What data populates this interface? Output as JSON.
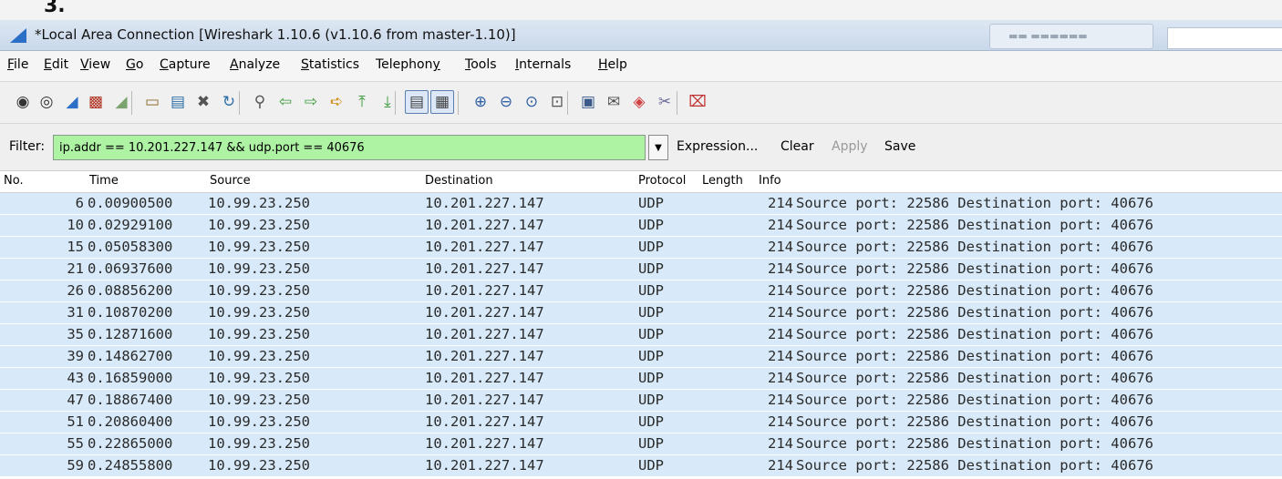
{
  "caption": "3.",
  "window": {
    "title": "*Local Area Connection  [Wireshark 1.10.6  (v1.10.6 from master-1.10)]"
  },
  "menu": {
    "items": [
      {
        "mnemonic": "F",
        "rest": "ile"
      },
      {
        "mnemonic": "E",
        "rest": "dit"
      },
      {
        "mnemonic": "V",
        "rest": "iew"
      },
      {
        "mnemonic": "G",
        "rest": "o"
      },
      {
        "mnemonic": "C",
        "rest": "apture"
      },
      {
        "mnemonic": "A",
        "rest": "nalyze"
      },
      {
        "mnemonic": "S",
        "rest": "tatistics"
      },
      {
        "pre": "Telephon",
        "mnemonic": "y",
        "rest": ""
      },
      {
        "mnemonic": "T",
        "rest": "ools"
      },
      {
        "mnemonic": "I",
        "rest": "nternals"
      },
      {
        "mnemonic": "H",
        "rest": "elp"
      }
    ]
  },
  "toolbar": {
    "icons": [
      "interface-list-icon",
      "capture-options-icon",
      "start-capture-icon",
      "stop-capture-icon",
      "restart-capture-icon",
      "open-file-icon",
      "save-file-icon",
      "close-file-icon",
      "reload-icon",
      "find-packet-icon",
      "go-back-icon",
      "go-forward-icon",
      "go-to-packet-icon",
      "go-first-icon",
      "go-last-icon",
      "colorize-icon",
      "autoscroll-icon",
      "zoom-in-icon",
      "zoom-out-icon",
      "normal-size-icon",
      "resize-columns-icon",
      "capture-filters-icon",
      "display-filters-icon",
      "coloring-rules-icon",
      "preferences-icon",
      "help-icon"
    ]
  },
  "filter": {
    "label": "Filter:",
    "value": "ip.addr == 10.201.227.147 && udp.port == 40676",
    "expression": "Expression...",
    "clear": "Clear",
    "apply": "Apply",
    "save": "Save"
  },
  "columns": [
    "No.",
    "Time",
    "Source",
    "Destination",
    "Protocol",
    "Length",
    "Info"
  ],
  "packets": [
    {
      "no": "6",
      "time": "0.00900500",
      "src": "10.99.23.250",
      "dst": "10.201.227.147",
      "proto": "UDP",
      "len": "214",
      "info": "Source port: 22586  Destination port: 40676"
    },
    {
      "no": "10",
      "time": "0.02929100",
      "src": "10.99.23.250",
      "dst": "10.201.227.147",
      "proto": "UDP",
      "len": "214",
      "info": "Source port: 22586  Destination port: 40676"
    },
    {
      "no": "15",
      "time": "0.05058300",
      "src": "10.99.23.250",
      "dst": "10.201.227.147",
      "proto": "UDP",
      "len": "214",
      "info": "Source port: 22586  Destination port: 40676"
    },
    {
      "no": "21",
      "time": "0.06937600",
      "src": "10.99.23.250",
      "dst": "10.201.227.147",
      "proto": "UDP",
      "len": "214",
      "info": "Source port: 22586  Destination port: 40676"
    },
    {
      "no": "26",
      "time": "0.08856200",
      "src": "10.99.23.250",
      "dst": "10.201.227.147",
      "proto": "UDP",
      "len": "214",
      "info": "Source port: 22586  Destination port: 40676"
    },
    {
      "no": "31",
      "time": "0.10870200",
      "src": "10.99.23.250",
      "dst": "10.201.227.147",
      "proto": "UDP",
      "len": "214",
      "info": "Source port: 22586  Destination port: 40676"
    },
    {
      "no": "35",
      "time": "0.12871600",
      "src": "10.99.23.250",
      "dst": "10.201.227.147",
      "proto": "UDP",
      "len": "214",
      "info": "Source port: 22586  Destination port: 40676"
    },
    {
      "no": "39",
      "time": "0.14862700",
      "src": "10.99.23.250",
      "dst": "10.201.227.147",
      "proto": "UDP",
      "len": "214",
      "info": "Source port: 22586  Destination port: 40676"
    },
    {
      "no": "43",
      "time": "0.16859000",
      "src": "10.99.23.250",
      "dst": "10.201.227.147",
      "proto": "UDP",
      "len": "214",
      "info": "Source port: 22586  Destination port: 40676"
    },
    {
      "no": "47",
      "time": "0.18867400",
      "src": "10.99.23.250",
      "dst": "10.201.227.147",
      "proto": "UDP",
      "len": "214",
      "info": "Source port: 22586  Destination port: 40676"
    },
    {
      "no": "51",
      "time": "0.20860400",
      "src": "10.99.23.250",
      "dst": "10.201.227.147",
      "proto": "UDP",
      "len": "214",
      "info": "Source port: 22586  Destination port: 40676"
    },
    {
      "no": "55",
      "time": "0.22865000",
      "src": "10.99.23.250",
      "dst": "10.201.227.147",
      "proto": "UDP",
      "len": "214",
      "info": "Source port: 22586  Destination port: 40676"
    },
    {
      "no": "59",
      "time": "0.24855800",
      "src": "10.99.23.250",
      "dst": "10.201.227.147",
      "proto": "UDP",
      "len": "214",
      "info": "Source port: 22586  Destination port: 40676"
    }
  ],
  "colors": {
    "filter_valid": "#aef2a4",
    "row_udp": "#d8eaf9",
    "titlebar": "#c9d8ea"
  }
}
